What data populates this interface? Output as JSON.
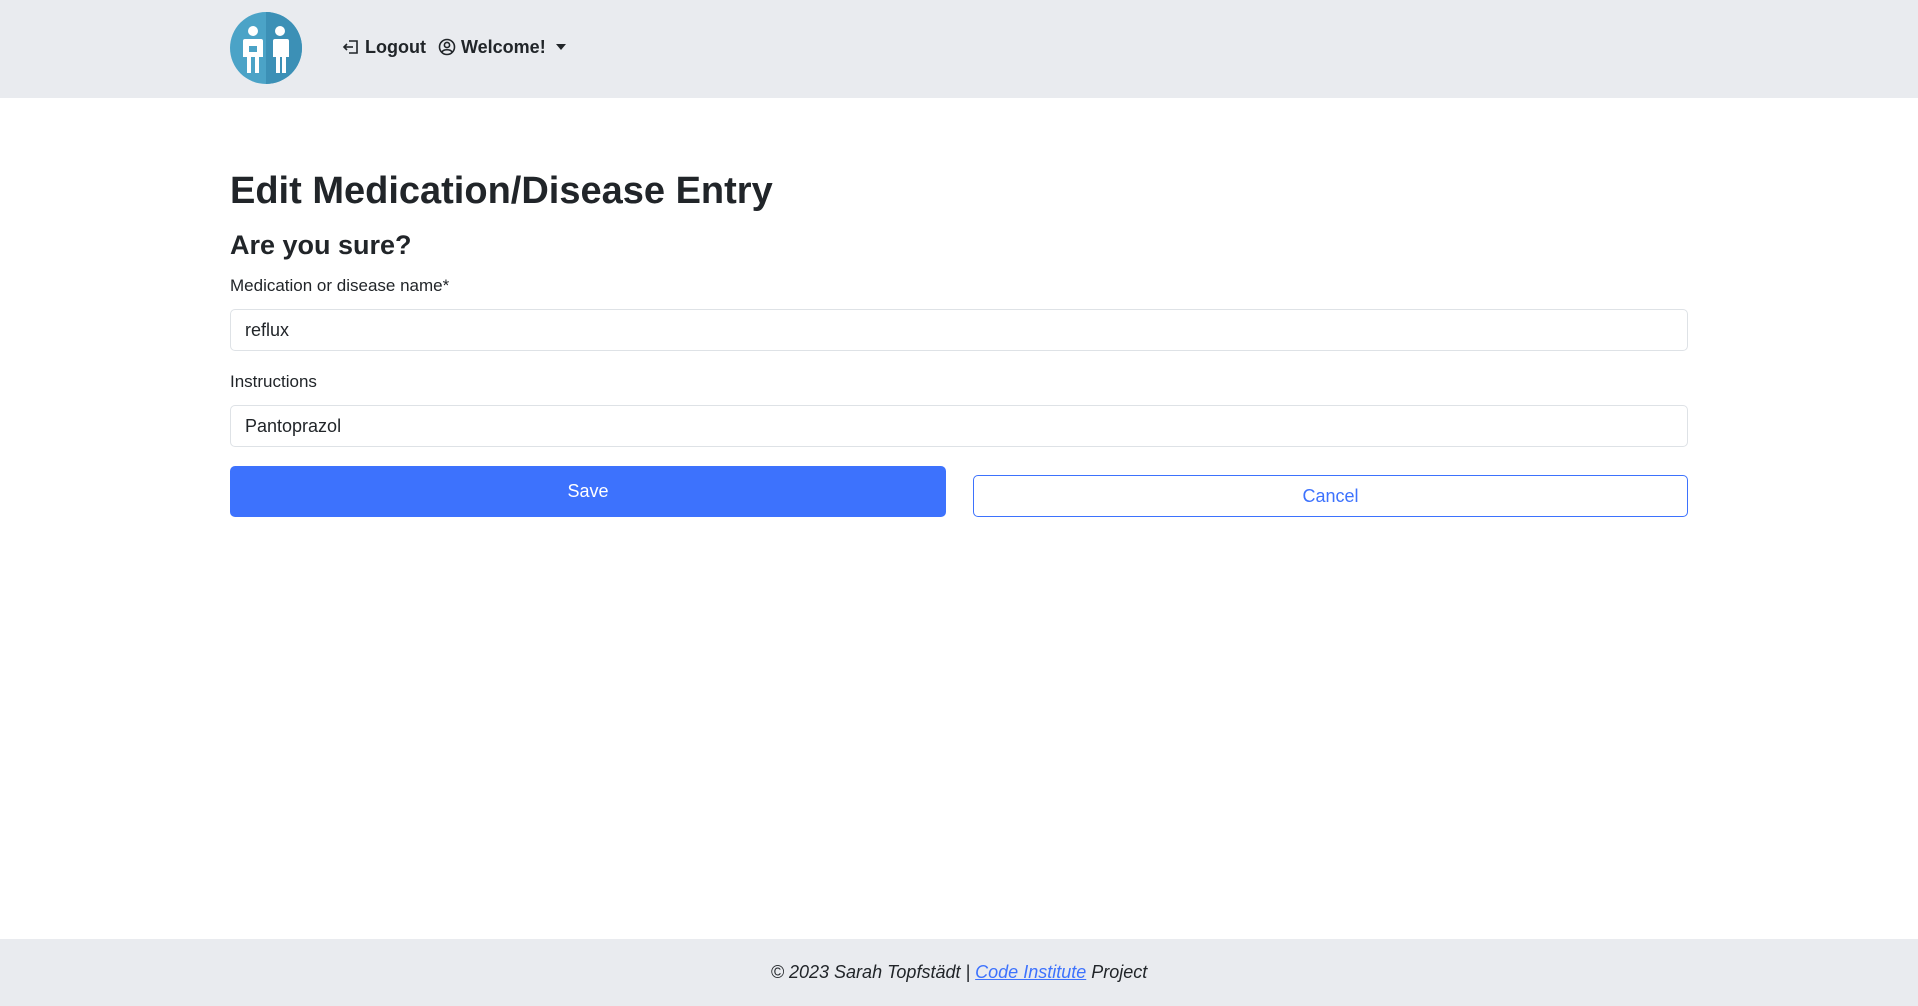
{
  "navbar": {
    "logo_icon": "doctor-patient-icon",
    "logout_label": "Logout",
    "logout_icon": "logout-arrow-icon",
    "welcome_label": "Welcome!",
    "welcome_icon": "user-circle-icon",
    "dropdown_icon": "caret-down-icon"
  },
  "main": {
    "title": "Edit Medication/Disease Entry",
    "subtitle": "Are you sure?",
    "name_label": "Medication or disease name*",
    "name_value": "reflux",
    "instructions_label": "Instructions",
    "instructions_value": "Pantoprazol",
    "save_label": "Save",
    "cancel_label": "Cancel"
  },
  "footer": {
    "prefix": "© 2023 Sarah Topfstädt | ",
    "link_text": "Code Institute",
    "suffix": " Project"
  },
  "colors": {
    "primary": "#3d72fd",
    "navbar_bg": "#e9ebef",
    "logo_bg": "#4ba3c7"
  }
}
